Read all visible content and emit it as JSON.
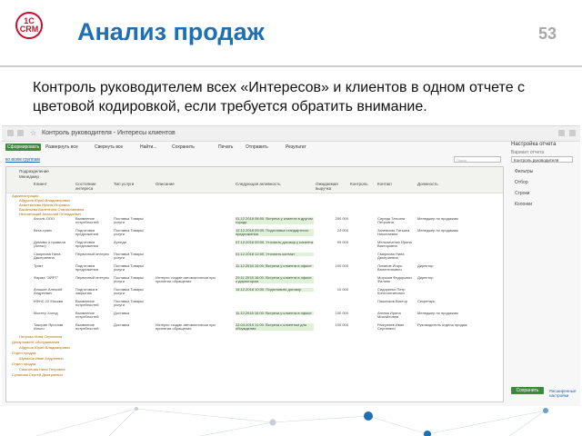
{
  "logo": {
    "line1": "1C",
    "line2": "CRM"
  },
  "title": "Анализ продаж",
  "page_number": "53",
  "subtitle": "Контроль руководителем всех «Интересов» и клиентов в одном отчете с цветовой кодировкой, если требуется обратить внимание.",
  "window": {
    "title": "Контроль руководителя - Интересы клиентов"
  },
  "toolbar": {
    "generate": "Сформировать",
    "expand": "Развернуть все",
    "collapse": "Свернуть все",
    "find": "Найти...",
    "save": "Сохранить",
    "print": "Печать",
    "send": "Отправить",
    "result": "Результат"
  },
  "link_all_groups": "ко всем группам",
  "search_placeholder": "Поиск",
  "header": {
    "division": "Подразделение",
    "manager": "Менеджер"
  },
  "columns": [
    "Клиент",
    "Состояние интереса",
    "Тип услуги",
    "Описание",
    "Следующая активность",
    "Ожидаемая выручка",
    "Контроль",
    "Контакт",
    "Должность"
  ],
  "groups": [
    "Администрация",
    "Абдулов Юрий Владимирович",
    "Ахметзянова Ирина Игоревна",
    "Васильева Валентина Станиславовна",
    "Непомнящий Анатолий Геннадьевич"
  ],
  "rows": [
    {
      "client": "Агсоль ООО",
      "state": "Выявление потребностей",
      "service": "Поставка Товары/услуги",
      "desc": "",
      "next": "01.12.2018 08:00. Встреча у клиента в другом городе",
      "revenue": "250 000",
      "contact": "Сиреда Татьяна Петровна",
      "position": "Менеджер по продажам"
    },
    {
      "client": "Вега-транс",
      "state": "Подготовка предложения",
      "service": "Поставка Товары/услуги",
      "desc": "",
      "next": "12.12.2018 09:00. Подготовка стандартного предложения",
      "revenue": "24 000",
      "contact": "Заневская Татьяна Николаевна",
      "position": "Менеджер по продажам"
    },
    {
      "client": "Домовы и правила (Алекс)",
      "state": "Подготовка предложения",
      "service": "Аренда",
      "desc": "",
      "next": "07.12.2018 09:00. Уточнить договор у клиента",
      "revenue": "99 000",
      "contact": "Мельниченко Ирина Викторовна",
      "position": ""
    },
    {
      "client": "Смирнова Нина Дмитриевна",
      "state": "Первичный интерес",
      "service": "Поставка Товары/услуги",
      "desc": "",
      "next": "01.12.2018 12:00. Уточнить контакт",
      "revenue": "",
      "contact": "Смирнова Нина Дмитриевна",
      "position": ""
    },
    {
      "client": "Трикт",
      "state": "Подготовка предложения",
      "service": "Поставка Товары/услуги",
      "desc": "",
      "next": "11.12.2018 10:00. Встреча у клиента в офисе",
      "revenue": "100 000",
      "contact": "Лоханов Игорь Валентинович",
      "position": "Директор"
    },
    {
      "client": "Фирма \"ЭЙРТ\"",
      "state": "Первичный интерес",
      "service": "Поставка Товары/услуги",
      "desc": "Интерес создан автоматически при принятии обращения",
      "next": "29.11.2018 16:00. Встреча у клиента в офисе с директором",
      "revenue": "",
      "contact": "Морозов Федорович Филипп",
      "position": "Директор"
    },
    {
      "client": "Аношин Алексей Андреевич",
      "state": "Подготовка в закрытию",
      "service": "Поставка Товары/услуги",
      "desc": "",
      "next": "14.12.2018 10:00. Подготовить договор",
      "revenue": "10 000",
      "contact": "Сидоренко Петр Константинович",
      "position": ""
    },
    {
      "client": "ИФНС 22 Москва",
      "state": "Выявление потребностей",
      "service": "Поставка Товары/услуги",
      "desc": "",
      "next": "",
      "revenue": "",
      "contact": "Пашников Виктор",
      "position": "Секретарь"
    },
    {
      "client": "Мастер Холод",
      "state": "Выявление потребностей",
      "service": "Доставка",
      "desc": "",
      "next": "11.12.2018 10:00. Встреча у клиента в офисе",
      "revenue": "100 000",
      "contact": "Агеева Ирина Михайловна",
      "position": "Менеджер по продажам"
    },
    {
      "client": "Такорин Ярослав Ильич",
      "state": "Выявление потребностей",
      "service": "Доставка",
      "desc": "Интерес создан автоматически при принятии обращения",
      "next": "22.04.2019 11:00. Встреча с клиентом для обсуждения",
      "revenue": "100 000",
      "contact": "Разгуляев Иван Сергеевич",
      "position": "Руководитель отдела продаж"
    }
  ],
  "groups_bottom": [
    "Петрова Нина Сергеевна",
    "Департамент обслуживания",
    "Абдулов Юрий Владимирович",
    "Отдел продаж",
    "Шувалов Иван Андреевич",
    "Отдел продаж",
    "Самсонова Нина Петровна",
    "Суханова Сергей Дмитриевич"
  ],
  "side": {
    "title": "Настройка отчета",
    "variant_label": "Вариант отчета",
    "variant_value": "Контроль руководителя",
    "items": [
      "Фильтры",
      "Отбор",
      "Строки",
      "Колонки"
    ],
    "save_button": "Сохранить",
    "more_link": "Расширенные настройки"
  }
}
